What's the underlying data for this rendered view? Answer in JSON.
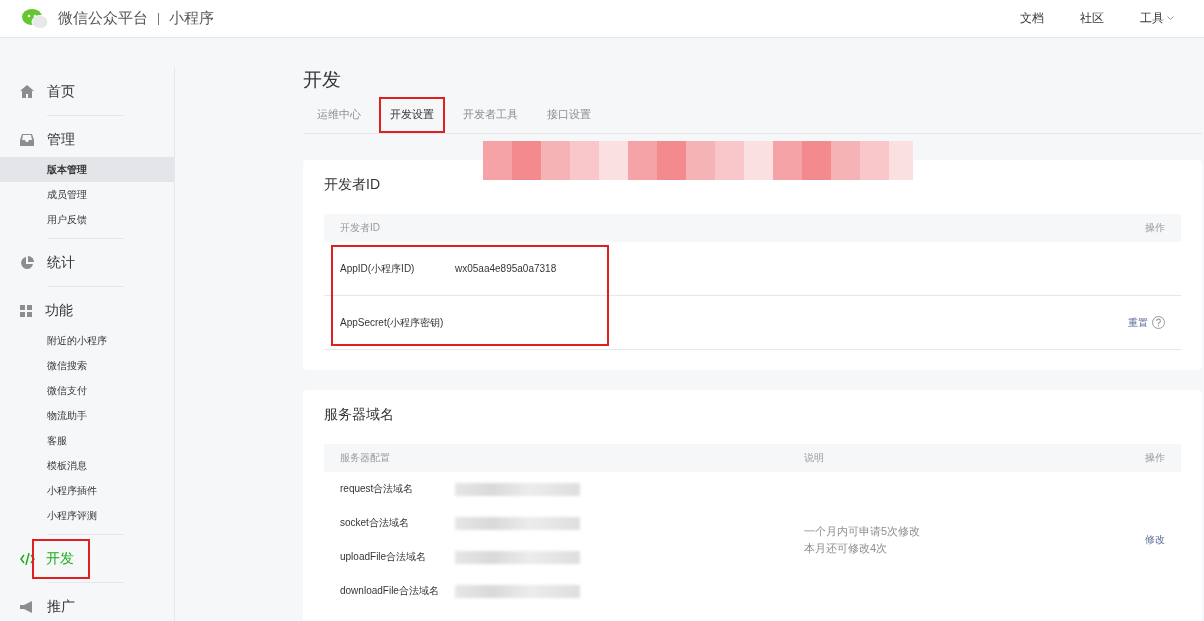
{
  "header": {
    "brand": "微信公众平台",
    "product": "小程序",
    "links": [
      {
        "label": "文档",
        "dropdown": false
      },
      {
        "label": "社区",
        "dropdown": false
      },
      {
        "label": "工具",
        "dropdown": true
      }
    ]
  },
  "sidebar": {
    "sections": [
      {
        "label": "首页",
        "kind": "home",
        "selected": false,
        "highlighted": false
      },
      {
        "label": "管理",
        "kind": "manage",
        "selected": false,
        "highlighted": false,
        "items": [
          {
            "label": "版本管理",
            "selected": true
          },
          {
            "label": "成员管理",
            "selected": false
          },
          {
            "label": "用户反馈",
            "selected": false
          }
        ]
      },
      {
        "label": "统计",
        "kind": "stats",
        "selected": false,
        "highlighted": false
      },
      {
        "label": "功能",
        "kind": "features",
        "selected": false,
        "highlighted": false,
        "items": [
          {
            "label": "附近的小程序",
            "selected": false
          },
          {
            "label": "微信搜索",
            "selected": false
          },
          {
            "label": "微信支付",
            "selected": false
          },
          {
            "label": "物流助手",
            "selected": false
          },
          {
            "label": "客服",
            "selected": false
          },
          {
            "label": "模板消息",
            "selected": false
          },
          {
            "label": "小程序插件",
            "selected": false
          },
          {
            "label": "小程序评测",
            "selected": false
          }
        ]
      },
      {
        "label": "开发",
        "kind": "develop",
        "selected": true,
        "highlighted": true
      },
      {
        "label": "推广",
        "kind": "promote",
        "selected": false,
        "highlighted": false
      }
    ]
  },
  "page": {
    "title": "开发",
    "tabs": [
      {
        "label": "运维中心",
        "selected": false,
        "highlighted": false
      },
      {
        "label": "开发设置",
        "selected": true,
        "highlighted": true
      },
      {
        "label": "开发者工具",
        "selected": false,
        "highlighted": false
      },
      {
        "label": "接口设置",
        "selected": false,
        "highlighted": false
      }
    ],
    "redacted_banner": true
  },
  "developer_id": {
    "title": "开发者ID",
    "columns": [
      "开发者ID",
      "操作"
    ],
    "highlighted": true,
    "rows": [
      {
        "label": "AppID(小程序ID)",
        "value": "wx05aa4e895a0a7318"
      },
      {
        "label": "AppSecret(小程序密钥)",
        "action": "重置",
        "help": true
      }
    ]
  },
  "server_domain": {
    "title": "服务器域名",
    "columns": [
      "服务器配置",
      "说明",
      "操作"
    ],
    "rows": [
      {
        "label": "request合法域名",
        "redacted": true
      },
      {
        "label": "socket合法域名",
        "redacted": true
      },
      {
        "label": "uploadFile合法域名",
        "redacted": true
      },
      {
        "label": "downloadFile合法域名",
        "redacted": true
      }
    ],
    "notes": [
      "一个月内可申请5次修改",
      "本月还可修改4次"
    ],
    "action": "修改"
  }
}
